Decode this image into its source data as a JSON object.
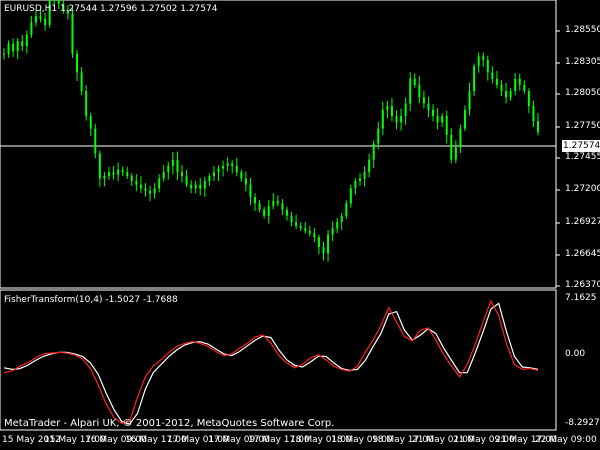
{
  "header": {
    "title": "EURUSD,H1  1.27544 1.27596 1.27502 1.27574"
  },
  "indicator": {
    "title": "FisherTransform(10,4) -1.5027 -1.7688"
  },
  "copyright": "MetaTrader - Alpari UK, © 2001-2012, MetaQuotes Software Corp.",
  "current_price": "1.27574",
  "colors": {
    "background": "#000000",
    "candle": "#00ff00",
    "grid": "#ffffff",
    "fisher_main": "#ff2020",
    "fisher_signal": "#ffffff"
  },
  "price_axis": [
    "1.28550",
    "1.28305",
    "1.28050",
    "1.27750",
    "1.27455",
    "1.27200",
    "1.26927",
    "1.26645",
    "1.26370"
  ],
  "indicator_axis": [
    "7.1625",
    "0.00",
    "-8.2927"
  ],
  "time_axis": [
    "15 May 2012",
    "15 May 17:00",
    "16 May 09:00",
    "16 May 17:00",
    "17 May 01:00",
    "17 May 09:00",
    "17 May 17:00",
    "18 May 01:00",
    "18 May 09:00",
    "18 May 17:00",
    "21 May 01:00",
    "21 May 09:00",
    "21 May 17:00",
    "22 May 09:00"
  ],
  "chart_data": {
    "type": "line",
    "price_close": [
      1.282,
      1.2828,
      1.2822,
      1.283,
      1.2826,
      1.2835,
      1.2845,
      1.285,
      1.2848,
      1.2843,
      1.2865,
      1.2868,
      1.286,
      1.2855,
      1.2852,
      1.282,
      1.2805,
      1.279,
      1.277,
      1.276,
      1.274,
      1.272,
      1.2722,
      1.2725,
      1.2723,
      1.2727,
      1.2725,
      1.2722,
      1.2718,
      1.2715,
      1.2712,
      1.271,
      1.2708,
      1.2712,
      1.272,
      1.2725,
      1.273,
      1.2735,
      1.2725,
      1.2722,
      1.2715,
      1.2712,
      1.2715,
      1.2712,
      1.2718,
      1.2722,
      1.2725,
      1.2728,
      1.273,
      1.2732,
      1.273,
      1.2725,
      1.272,
      1.2715,
      1.2705,
      1.27,
      1.2695,
      1.269,
      1.2698,
      1.2702,
      1.27,
      1.2695,
      1.269,
      1.2685,
      1.2682,
      1.268,
      1.2678,
      1.2676,
      1.2673,
      1.2665,
      1.266,
      1.2675,
      1.268,
      1.2685,
      1.269,
      1.27,
      1.2712,
      1.2718,
      1.272,
      1.2725,
      1.2735,
      1.2748,
      1.276,
      1.2775,
      1.2778,
      1.277,
      1.2765,
      1.277,
      1.278,
      1.28,
      1.2795,
      1.2785,
      1.278,
      1.2775,
      1.277,
      1.2765,
      1.277,
      1.2755,
      1.2735,
      1.2745,
      1.276,
      1.2775,
      1.279,
      1.281,
      1.2818,
      1.2815,
      1.2805,
      1.28,
      1.2795,
      1.279,
      1.2785,
      1.279,
      1.28,
      1.2795,
      1.279,
      1.2778,
      1.2766,
      1.2757
    ],
    "fisher_main": [
      -2.0,
      -1.8,
      -1.2,
      -0.8,
      -0.2,
      0.3,
      0.4,
      0.5,
      0.4,
      0.2,
      -0.3,
      -1.5,
      -3.5,
      -5.8,
      -7.5,
      -8.2,
      -8.0,
      -5.0,
      -2.5,
      -1.2,
      -0.4,
      0.5,
      1.2,
      1.6,
      1.8,
      1.6,
      1.2,
      0.6,
      0.1,
      0.3,
      1.0,
      1.6,
      2.4,
      2.6,
      1.6,
      0.1,
      -0.8,
      -1.4,
      -1.0,
      -0.2,
      0.2,
      -0.4,
      -1.2,
      -1.6,
      -1.8,
      -1.2,
      0.5,
      2.0,
      3.8,
      6.0,
      4.2,
      2.4,
      1.9,
      3.2,
      3.5,
      2.0,
      0.2,
      -1.2,
      -2.5,
      -1.0,
      1.5,
      4.2,
      6.8,
      5.0,
      1.5,
      -1.0,
      -1.6,
      -1.5,
      -1.7
    ],
    "fisher_signal": [
      -1.4,
      -1.6,
      -1.5,
      -1.1,
      -0.5,
      0.0,
      0.3,
      0.5,
      0.5,
      0.3,
      0.0,
      -0.8,
      -2.2,
      -4.5,
      -6.5,
      -8.0,
      -8.3,
      -7.0,
      -4.0,
      -2.0,
      -1.0,
      0.0,
      0.8,
      1.4,
      1.7,
      1.8,
      1.5,
      0.9,
      0.3,
      0.1,
      0.6,
      1.3,
      2.0,
      2.5,
      2.3,
      0.8,
      -0.4,
      -1.1,
      -1.3,
      -0.7,
      0.0,
      0.0,
      -0.8,
      -1.5,
      -1.7,
      -1.6,
      -0.5,
      1.2,
      2.8,
      5.2,
      5.5,
      3.2,
      2.0,
      2.6,
      3.4,
      2.8,
      1.0,
      -0.5,
      -2.0,
      -2.0,
      0.4,
      3.0,
      5.8,
      6.5,
      3.0,
      0.0,
      -1.3,
      -1.4,
      -1.6
    ],
    "ylim_price": [
      1.2637,
      1.2855
    ],
    "ylim_indicator": [
      -8.2927,
      7.1625
    ]
  }
}
